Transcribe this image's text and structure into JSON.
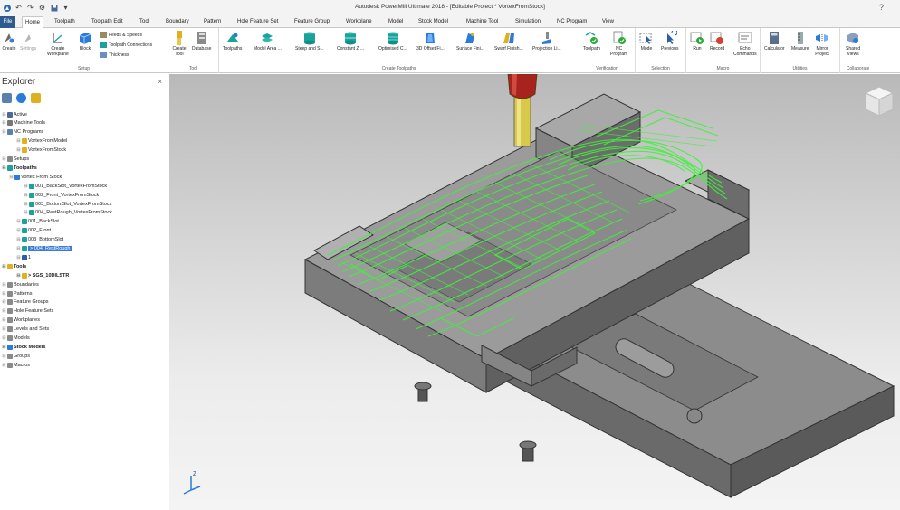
{
  "app": {
    "title": "Autodesk PowerMill Ultimate 2018 - [Editable Project * VortexFromStock]",
    "help_glyph": "?"
  },
  "tabs": [
    "File",
    "Home",
    "Toolpath",
    "Toolpath Edit",
    "Tool",
    "Boundary",
    "Pattern",
    "Hole Feature Set",
    "Feature Group",
    "Workplane",
    "Model",
    "Stock Model",
    "Machine Tool",
    "Simulation",
    "NC Program",
    "View"
  ],
  "active_tab": "Home",
  "ribbon": {
    "setup": {
      "label": "Setup",
      "create": "Create",
      "settings": "Settings",
      "create_workplane": "Create\nWorkplane",
      "block": "Block",
      "feeds": "Feeds & Speeds",
      "connections": "Toolpath Connections",
      "thickness": "Thickness"
    },
    "tool": {
      "label": "Tool",
      "create_tool": "Create\nTool",
      "database": "Database"
    },
    "create_toolpaths": {
      "label": "Create Toolpaths",
      "items": [
        "Toolpaths",
        "Model Area ...",
        "Steep and S...",
        "Constant Z ...",
        "Optimised C...",
        "3D Offset Fi...",
        "Surface Fini...",
        "Swarf Finish...",
        "Projection Li..."
      ]
    },
    "verification": {
      "label": "Verification",
      "toolpath": "Toolpath",
      "nc_program": "NC\nProgram"
    },
    "selection": {
      "label": "Selection",
      "mode": "Mode",
      "previous": "Previous"
    },
    "macro": {
      "label": "Macro",
      "run": "Run",
      "record": "Record",
      "echo": "Echo\nCommands"
    },
    "utilities": {
      "label": "Utilities",
      "calculator": "Calculator",
      "measure": "Measure",
      "mirror": "Mirror\nProject"
    },
    "collaborate": {
      "label": "Collaborate",
      "shared_views": "Shared\nViews"
    }
  },
  "explorer": {
    "title": "Explorer",
    "close_glyph": "×",
    "tree": [
      {
        "text": "Active",
        "indent": 0
      },
      {
        "text": "Machine Tools",
        "indent": 0
      },
      {
        "text": "NC Programs",
        "indent": 0
      },
      {
        "text": "VortexFromModel",
        "indent": 2
      },
      {
        "text": "VortexFromStock",
        "indent": 2
      },
      {
        "text": "Setups",
        "indent": 0
      },
      {
        "text": "Toolpaths",
        "indent": 0,
        "bold": true
      },
      {
        "text": "Vortex From Stock",
        "indent": 1
      },
      {
        "text": "001_BackSlot_VortexFromStock",
        "indent": 3
      },
      {
        "text": "002_Front_VortexFromStock",
        "indent": 3
      },
      {
        "text": "003_BottomSlot_VortexFromStock",
        "indent": 3
      },
      {
        "text": "004_RestRough_VortexFromStock",
        "indent": 3
      },
      {
        "text": "001_BackSlot",
        "indent": 2
      },
      {
        "text": "002_Front",
        "indent": 2
      },
      {
        "text": "003_BottomSlot",
        "indent": 2
      },
      {
        "text": "> 004_RestRough",
        "indent": 2,
        "selected": true
      },
      {
        "text": "1",
        "indent": 2
      },
      {
        "text": "Tools",
        "indent": 0,
        "bold": true
      },
      {
        "text": "> SGS_10DILSTR",
        "indent": 2,
        "bold": true
      },
      {
        "text": "Boundaries",
        "indent": 0
      },
      {
        "text": "Patterns",
        "indent": 0
      },
      {
        "text": "Feature Groups",
        "indent": 0
      },
      {
        "text": "Hole Feature Sets",
        "indent": 0
      },
      {
        "text": "Workplanes",
        "indent": 0
      },
      {
        "text": "Levels and Sets",
        "indent": 0
      },
      {
        "text": "Models",
        "indent": 0
      },
      {
        "text": "Stock Models",
        "indent": 0,
        "bold": true
      },
      {
        "text": "Groups",
        "indent": 0
      },
      {
        "text": "Macros",
        "indent": 0
      }
    ]
  },
  "viewport": {
    "axis_label": "Z",
    "toolpath_color": "#3ef23a",
    "stock_color": "#7a7a7a"
  },
  "colors": {
    "file_tab": "#2d5b8f",
    "selection": "#3a7bd5",
    "accent_teal": "#1aa39a",
    "accent_blue": "#2b7bd8"
  }
}
